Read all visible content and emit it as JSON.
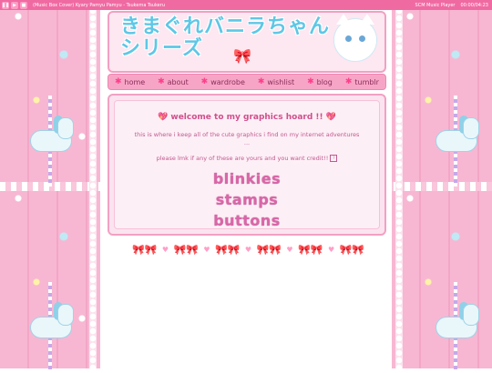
{
  "music_bar": {
    "buttons": [
      "❚❚",
      "▶",
      "■"
    ],
    "track": "(Music Box Cover) Kyary Pamyu Pamyu - Tsukema Tsukeru",
    "player": "SCM Music Player",
    "time": "00:00/04:23"
  },
  "header": {
    "title_line1": "きまぐれバニラちゃん",
    "title_line2": "シリーズ",
    "bow": "🎀"
  },
  "nav": {
    "items": [
      {
        "label": "home"
      },
      {
        "label": "about"
      },
      {
        "label": "wardrobe"
      },
      {
        "label": "wishlist"
      },
      {
        "label": "blog"
      },
      {
        "label": "tumblr"
      }
    ],
    "star_glyph": "✱"
  },
  "content": {
    "welcome": "welcome to my graphics hoard !!",
    "heart_glyph": "💖",
    "description": "this is where i keep all of the cute graphics i find on my internet adventures ...",
    "credit_note": "please lmk if any of these are yours and you want credit!!",
    "credit_icon": "?",
    "links": {
      "blinkies": "blinkies",
      "stamps": "stamps",
      "buttons": "buttons"
    }
  },
  "divider": {
    "bow_glyph": "🎀🎀",
    "heart_glyph": "♥"
  },
  "colors": {
    "accent_pink": "#f06aa2",
    "panel_pink": "#fbe4ef",
    "text_pink": "#c05a90",
    "title_blue": "#5ec7e6"
  }
}
